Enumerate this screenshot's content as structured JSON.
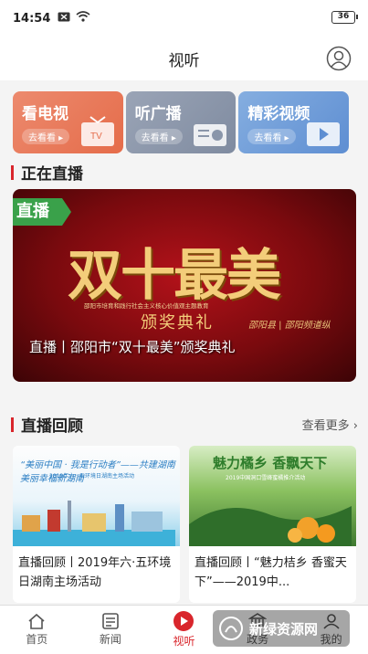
{
  "status": {
    "time": "14:54",
    "battery": "36"
  },
  "header": {
    "title": "视听"
  },
  "categories": [
    {
      "label": "看电视",
      "go": "去看看 ▸"
    },
    {
      "label": "听广播",
      "go": "去看看 ▸"
    },
    {
      "label": "精彩视频",
      "go": "去看看 ▸"
    }
  ],
  "live": {
    "section_title": "正在直播",
    "tag": "直播",
    "banner_title": "双十最美",
    "banner_sub": "邵阳市培育和践行社会主义核心价值观主题教育",
    "banner_award": "颁奖典礼",
    "banner_brand": "邵阳县 | 邵阳频道纵",
    "caption": "直播丨邵阳市“双十最美”颁奖典礼"
  },
  "replay": {
    "section_title": "直播回顾",
    "more": "查看更多 ›",
    "cards": [
      {
        "thumb_head": "“美丽中国 · 我是行动者”——共建湖南美丽幸福新湖南",
        "thumb_sub": "2019年六 · 五环境日湖南主场活动",
        "title": "直播回顾丨2019年六·五环境日湖南主场活动"
      },
      {
        "thumb_head": "魅力橘乡 香飘天下",
        "thumb_sub": "2019中国洞口雪峰蜜橘推介活动",
        "title": "直播回顾丨“魅力桔乡 香蜜天下”——2019中..."
      }
    ]
  },
  "tabs": [
    {
      "label": "首页"
    },
    {
      "label": "新闻"
    },
    {
      "label": "视听"
    },
    {
      "label": "政务"
    },
    {
      "label": "我的"
    }
  ],
  "watermark": {
    "text": "新绿资源网"
  }
}
